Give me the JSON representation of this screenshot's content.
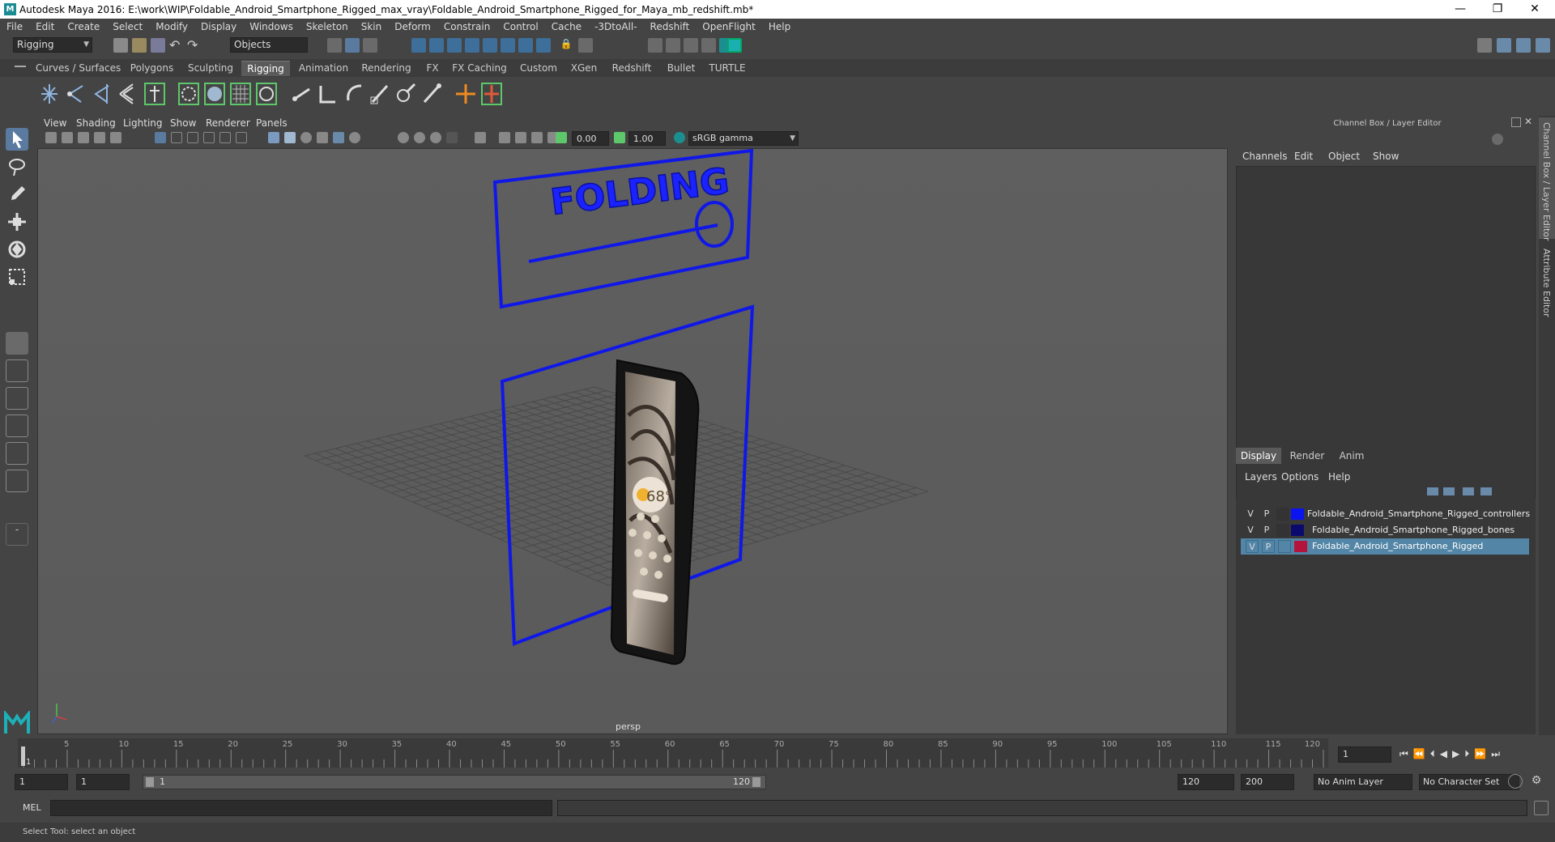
{
  "window": {
    "title": "Autodesk Maya 2016: E:\\work\\WIP\\Foldable_Android_Smartphone_Rigged_max_vray\\Foldable_Android_Smartphone_Rigged_for_Maya_mb_redshift.mb*",
    "minimize": "—",
    "restore": "❐",
    "close": "✕"
  },
  "menubar": [
    "File",
    "Edit",
    "Create",
    "Select",
    "Modify",
    "Display",
    "Windows",
    "Skeleton",
    "Skin",
    "Deform",
    "Constrain",
    "Control",
    "Cache",
    "-3DtoAll-",
    "Redshift",
    "OpenFlight",
    "Help"
  ],
  "statusline": {
    "mode": "Rigging",
    "selection_mode": "Objects"
  },
  "shelf_tabs": [
    "Curves / Surfaces",
    "Polygons",
    "Sculpting",
    "Rigging",
    "Animation",
    "Rendering",
    "FX",
    "FX Caching",
    "Custom",
    "XGen",
    "Redshift",
    "Bullet",
    "TURTLE"
  ],
  "active_shelf": "Rigging",
  "viewport": {
    "menu": [
      "View",
      "Shading",
      "Lighting",
      "Show",
      "Renderer",
      "Panels"
    ],
    "field_a": "0.00",
    "field_b": "1.00",
    "color_space": "sRGB gamma",
    "camera_label": "persp",
    "folding_text": "FOLDING",
    "phone_temp": "68°"
  },
  "channel_box": {
    "title": "Channel Box / Layer Editor",
    "menu": [
      "Channels",
      "Edit",
      "Object",
      "Show"
    ],
    "side_tab_1": "Channel Box / Layer Editor",
    "side_tab_2": "Attribute Editor"
  },
  "layer_editor": {
    "tabs": [
      "Display",
      "Render",
      "Anim"
    ],
    "active_tab": "Display",
    "menu": [
      "Layers",
      "Options",
      "Help"
    ],
    "layers": [
      {
        "v": "V",
        "p": "P",
        "color": "#0a14f0",
        "name": "Foldable_Android_Smartphone_Rigged_controllers",
        "selected": false
      },
      {
        "v": "V",
        "p": "P",
        "color": "#0a0a6e",
        "name": "Foldable_Android_Smartphone_Rigged_bones",
        "selected": false
      },
      {
        "v": "V",
        "p": "P",
        "color": "#b4143c",
        "name": "Foldable_Android_Smartphone_Rigged",
        "selected": true
      }
    ]
  },
  "timeline": {
    "labels": [
      "1",
      "5",
      "10",
      "15",
      "20",
      "25",
      "30",
      "35",
      "40",
      "45",
      "50",
      "55",
      "60",
      "65",
      "70",
      "75",
      "80",
      "85",
      "90",
      "95",
      "100",
      "105",
      "110",
      "115",
      "120"
    ],
    "current_frame": "1"
  },
  "range": {
    "start": "1",
    "inner_start": "1",
    "slider_start": "1",
    "slider_end": "120",
    "end": "120",
    "anim_end": "200",
    "anim_layer": "No Anim Layer",
    "char_set": "No Character Set"
  },
  "command": {
    "label": "MEL"
  },
  "help_line": "Select Tool: select an object"
}
